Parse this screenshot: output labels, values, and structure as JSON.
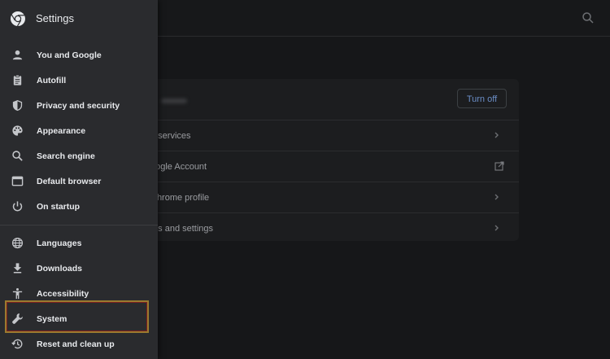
{
  "drawer": {
    "title": "Settings",
    "groups": [
      [
        {
          "label": "You and Google",
          "icon": "person-icon"
        },
        {
          "label": "Autofill",
          "icon": "clipboard-icon"
        },
        {
          "label": "Privacy and security",
          "icon": "shield-icon"
        },
        {
          "label": "Appearance",
          "icon": "palette-icon"
        },
        {
          "label": "Search engine",
          "icon": "search-icon"
        },
        {
          "label": "Default browser",
          "icon": "browser-window-icon"
        },
        {
          "label": "On startup",
          "icon": "power-icon"
        }
      ],
      [
        {
          "label": "Languages",
          "icon": "globe-icon"
        },
        {
          "label": "Downloads",
          "icon": "download-icon"
        },
        {
          "label": "Accessibility",
          "icon": "accessibility-icon"
        },
        {
          "label": "System",
          "icon": "wrench-icon"
        },
        {
          "label": "Reset and clean up",
          "icon": "restore-icon"
        }
      ]
    ]
  },
  "main": {
    "turn_off_label": "Turn off",
    "rows": [
      {
        "text": "e services",
        "trailing": "chevron-right-icon"
      },
      {
        "text": "oogle Account",
        "trailing": "external-link-icon"
      },
      {
        "text": "Chrome profile",
        "trailing": "chevron-right-icon"
      },
      {
        "text": "rks and settings",
        "trailing": "chevron-right-icon"
      }
    ]
  },
  "colors": {
    "drawer_bg": "#2a2b2e",
    "page_bg": "#161719",
    "text_primary": "#e8eaed",
    "accent_blue": "#6b8ec7",
    "highlight_border": "#9a7a2f"
  }
}
